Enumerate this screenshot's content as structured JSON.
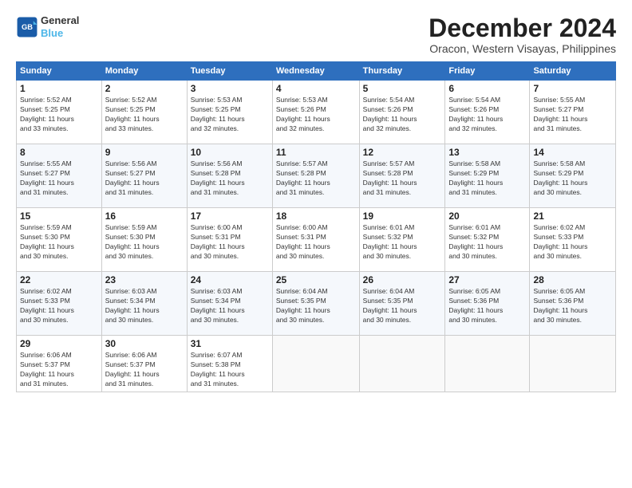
{
  "header": {
    "logo_line1": "General",
    "logo_line2": "Blue",
    "month": "December 2024",
    "location": "Oracon, Western Visayas, Philippines"
  },
  "days_of_week": [
    "Sunday",
    "Monday",
    "Tuesday",
    "Wednesday",
    "Thursday",
    "Friday",
    "Saturday"
  ],
  "weeks": [
    [
      {
        "day": "1",
        "info": "Sunrise: 5:52 AM\nSunset: 5:25 PM\nDaylight: 11 hours\nand 33 minutes."
      },
      {
        "day": "2",
        "info": "Sunrise: 5:52 AM\nSunset: 5:25 PM\nDaylight: 11 hours\nand 33 minutes."
      },
      {
        "day": "3",
        "info": "Sunrise: 5:53 AM\nSunset: 5:25 PM\nDaylight: 11 hours\nand 32 minutes."
      },
      {
        "day": "4",
        "info": "Sunrise: 5:53 AM\nSunset: 5:26 PM\nDaylight: 11 hours\nand 32 minutes."
      },
      {
        "day": "5",
        "info": "Sunrise: 5:54 AM\nSunset: 5:26 PM\nDaylight: 11 hours\nand 32 minutes."
      },
      {
        "day": "6",
        "info": "Sunrise: 5:54 AM\nSunset: 5:26 PM\nDaylight: 11 hours\nand 32 minutes."
      },
      {
        "day": "7",
        "info": "Sunrise: 5:55 AM\nSunset: 5:27 PM\nDaylight: 11 hours\nand 31 minutes."
      }
    ],
    [
      {
        "day": "8",
        "info": "Sunrise: 5:55 AM\nSunset: 5:27 PM\nDaylight: 11 hours\nand 31 minutes."
      },
      {
        "day": "9",
        "info": "Sunrise: 5:56 AM\nSunset: 5:27 PM\nDaylight: 11 hours\nand 31 minutes."
      },
      {
        "day": "10",
        "info": "Sunrise: 5:56 AM\nSunset: 5:28 PM\nDaylight: 11 hours\nand 31 minutes."
      },
      {
        "day": "11",
        "info": "Sunrise: 5:57 AM\nSunset: 5:28 PM\nDaylight: 11 hours\nand 31 minutes."
      },
      {
        "day": "12",
        "info": "Sunrise: 5:57 AM\nSunset: 5:28 PM\nDaylight: 11 hours\nand 31 minutes."
      },
      {
        "day": "13",
        "info": "Sunrise: 5:58 AM\nSunset: 5:29 PM\nDaylight: 11 hours\nand 31 minutes."
      },
      {
        "day": "14",
        "info": "Sunrise: 5:58 AM\nSunset: 5:29 PM\nDaylight: 11 hours\nand 30 minutes."
      }
    ],
    [
      {
        "day": "15",
        "info": "Sunrise: 5:59 AM\nSunset: 5:30 PM\nDaylight: 11 hours\nand 30 minutes."
      },
      {
        "day": "16",
        "info": "Sunrise: 5:59 AM\nSunset: 5:30 PM\nDaylight: 11 hours\nand 30 minutes."
      },
      {
        "day": "17",
        "info": "Sunrise: 6:00 AM\nSunset: 5:31 PM\nDaylight: 11 hours\nand 30 minutes."
      },
      {
        "day": "18",
        "info": "Sunrise: 6:00 AM\nSunset: 5:31 PM\nDaylight: 11 hours\nand 30 minutes."
      },
      {
        "day": "19",
        "info": "Sunrise: 6:01 AM\nSunset: 5:32 PM\nDaylight: 11 hours\nand 30 minutes."
      },
      {
        "day": "20",
        "info": "Sunrise: 6:01 AM\nSunset: 5:32 PM\nDaylight: 11 hours\nand 30 minutes."
      },
      {
        "day": "21",
        "info": "Sunrise: 6:02 AM\nSunset: 5:33 PM\nDaylight: 11 hours\nand 30 minutes."
      }
    ],
    [
      {
        "day": "22",
        "info": "Sunrise: 6:02 AM\nSunset: 5:33 PM\nDaylight: 11 hours\nand 30 minutes."
      },
      {
        "day": "23",
        "info": "Sunrise: 6:03 AM\nSunset: 5:34 PM\nDaylight: 11 hours\nand 30 minutes."
      },
      {
        "day": "24",
        "info": "Sunrise: 6:03 AM\nSunset: 5:34 PM\nDaylight: 11 hours\nand 30 minutes."
      },
      {
        "day": "25",
        "info": "Sunrise: 6:04 AM\nSunset: 5:35 PM\nDaylight: 11 hours\nand 30 minutes."
      },
      {
        "day": "26",
        "info": "Sunrise: 6:04 AM\nSunset: 5:35 PM\nDaylight: 11 hours\nand 30 minutes."
      },
      {
        "day": "27",
        "info": "Sunrise: 6:05 AM\nSunset: 5:36 PM\nDaylight: 11 hours\nand 30 minutes."
      },
      {
        "day": "28",
        "info": "Sunrise: 6:05 AM\nSunset: 5:36 PM\nDaylight: 11 hours\nand 30 minutes."
      }
    ],
    [
      {
        "day": "29",
        "info": "Sunrise: 6:06 AM\nSunset: 5:37 PM\nDaylight: 11 hours\nand 31 minutes."
      },
      {
        "day": "30",
        "info": "Sunrise: 6:06 AM\nSunset: 5:37 PM\nDaylight: 11 hours\nand 31 minutes."
      },
      {
        "day": "31",
        "info": "Sunrise: 6:07 AM\nSunset: 5:38 PM\nDaylight: 11 hours\nand 31 minutes."
      },
      {
        "day": "",
        "info": ""
      },
      {
        "day": "",
        "info": ""
      },
      {
        "day": "",
        "info": ""
      },
      {
        "day": "",
        "info": ""
      }
    ]
  ]
}
